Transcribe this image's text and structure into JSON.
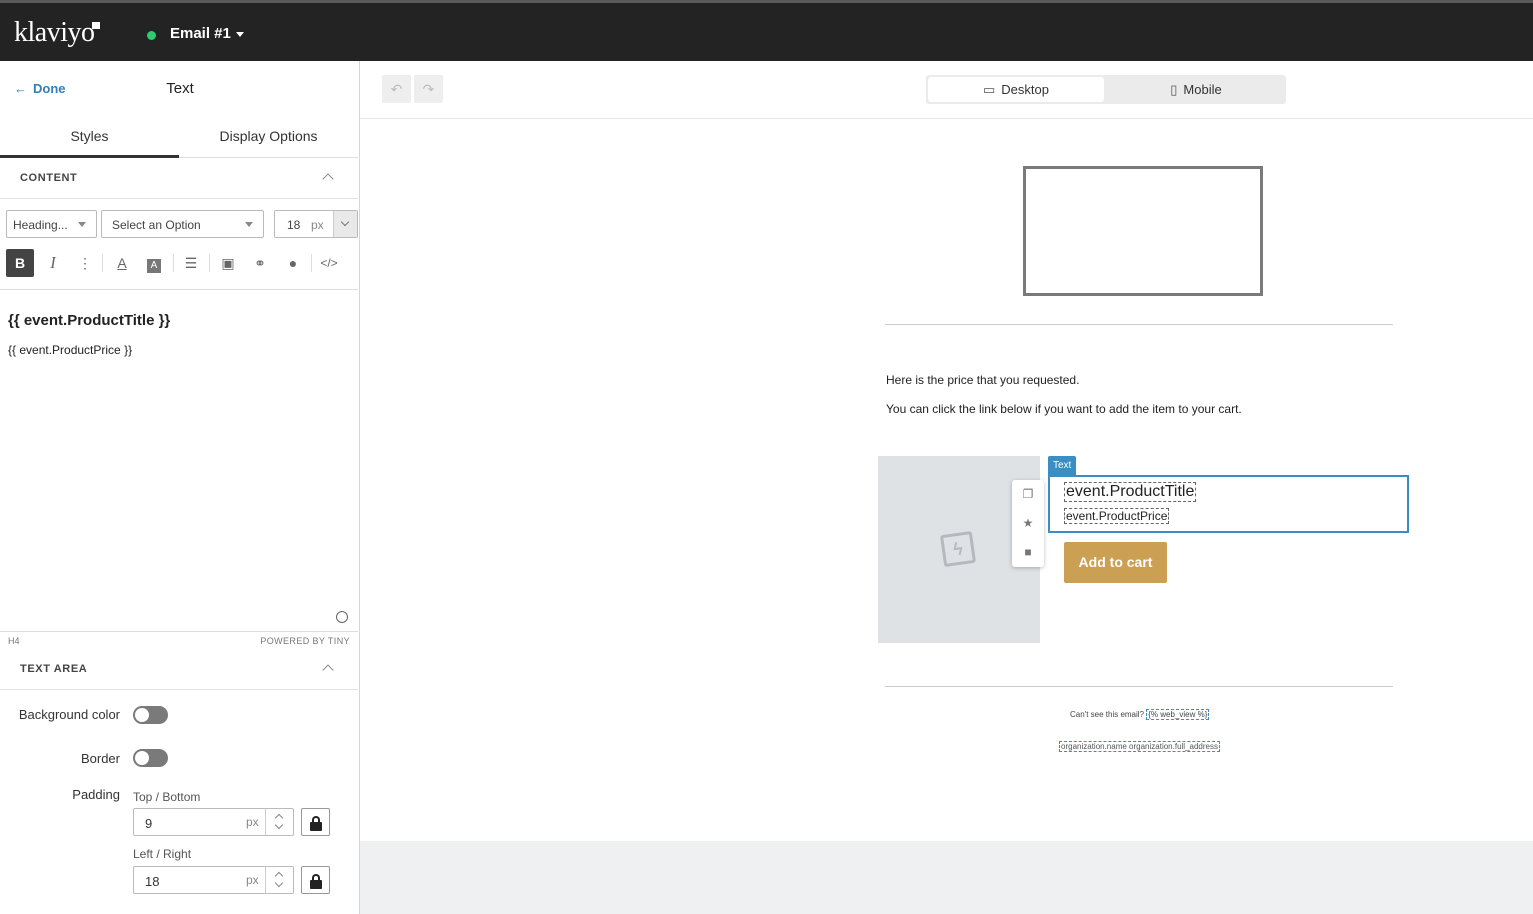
{
  "app": {
    "logo_text": "klaviyo",
    "email_title": "Email #1",
    "status_color": "#2ecc71"
  },
  "sidebar": {
    "done_label": "Done",
    "title": "Text",
    "tabs": [
      {
        "label": "Styles",
        "active": true
      },
      {
        "label": "Display Options",
        "active": false
      }
    ],
    "content_section": {
      "header": "CONTENT",
      "format_dropdown": "Heading...",
      "font_dropdown": "Select an Option",
      "font_size": "18",
      "font_size_unit": "px"
    },
    "toolbar_icons": [
      "bold-icon",
      "italic-icon",
      "more-icon",
      "text-color-icon",
      "background-color-icon",
      "align-icon",
      "image-icon",
      "link-icon",
      "personalize-icon",
      "code-icon"
    ],
    "editor": {
      "heading": "{{ event.ProductTitle }}",
      "paragraph": "{{ event.ProductPrice }}",
      "element_path": "H4",
      "powered_by": "POWERED BY TINY"
    },
    "text_area_section": {
      "header": "TEXT AREA",
      "background_color_label": "Background color",
      "background_color_on": false,
      "border_label": "Border",
      "border_on": false,
      "padding_label": "Padding",
      "top_bottom_label": "Top / Bottom",
      "top_bottom_value": "9",
      "left_right_label": "Left / Right",
      "left_right_value": "18",
      "unit": "px"
    }
  },
  "canvas": {
    "view_toggle": [
      {
        "label": "Desktop",
        "active": true
      },
      {
        "label": "Mobile",
        "active": false
      }
    ],
    "message_line1": "Here is the price that you requested.",
    "message_line2": "You can click the link below if you want to add the item to your cart.",
    "selected_block_tag": "Text",
    "product_title": "event.ProductTitle",
    "product_price": "event.ProductPrice",
    "cart_button": "Add to cart",
    "cart_button_color": "#cca052",
    "footer_text": "Can't see this email?",
    "footer_link": "{% web_view %}",
    "footer_address": "organization.name organization.full_address"
  }
}
